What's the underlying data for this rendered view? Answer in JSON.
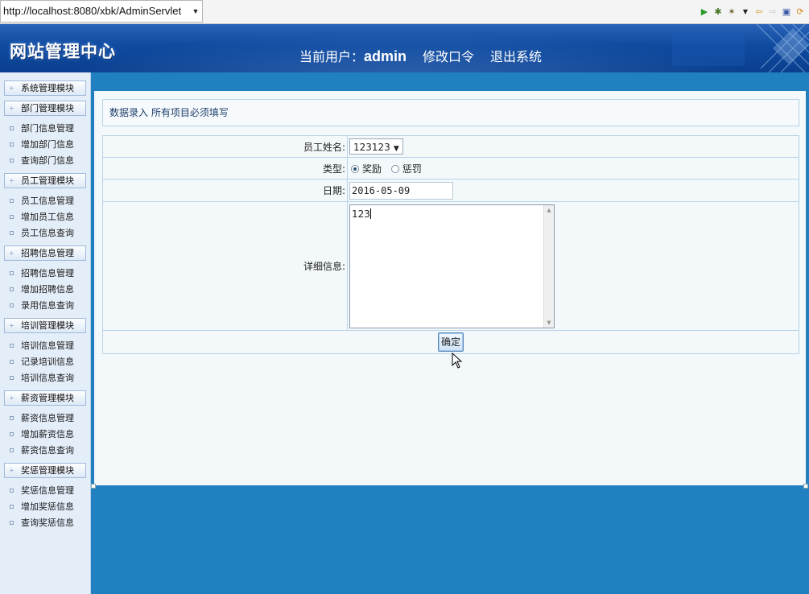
{
  "browser": {
    "url": "http://localhost:8080/xbk/AdminServlet",
    "dropdown_icon": "chevron-down-icon",
    "toolbar_icons": [
      "run-icon",
      "debug-icon",
      "tools-icon",
      "back-icon",
      "forward-icon",
      "stop-icon",
      "refresh-icon"
    ]
  },
  "header": {
    "title": "网站管理中心",
    "current_user_label": "当前用户：",
    "current_user": "admin",
    "change_password": "修改口令",
    "logout": "退出系统"
  },
  "sidebar": {
    "groups": [
      {
        "label": "系统管理模块",
        "items": []
      },
      {
        "label": "部门管理模块",
        "items": [
          "部门信息管理",
          "增加部门信息",
          "查询部门信息"
        ]
      },
      {
        "label": "员工管理模块",
        "items": [
          "员工信息管理",
          "增加员工信息",
          "员工信息查询"
        ]
      },
      {
        "label": "招聘信息管理",
        "items": [
          "招聘信息管理",
          "增加招聘信息",
          "录用信息查询"
        ]
      },
      {
        "label": "培训管理模块",
        "items": [
          "培训信息管理",
          "记录培训信息",
          "培训信息查询"
        ]
      },
      {
        "label": "薪资管理模块",
        "items": [
          "薪资信息管理",
          "增加薪资信息",
          "薪资信息查询"
        ]
      },
      {
        "label": "奖惩管理模块",
        "items": [
          "奖惩信息管理",
          "增加奖惩信息",
          "查询奖惩信息"
        ]
      }
    ]
  },
  "form": {
    "notice": "数据录入  所有项目必须填写",
    "employee_label": "员工姓名:",
    "employee_value": "123123",
    "type_label": "类型:",
    "type_options": [
      "奖励",
      "惩罚"
    ],
    "type_selected": "奖励",
    "date_label": "日期:",
    "date_value": "2016-05-09",
    "detail_label": "详细信息:",
    "detail_value": "123",
    "submit": "确定"
  },
  "colors": {
    "header_blue": "#0f4aa0",
    "main_bg": "#2180bf",
    "panel_bg": "#f3f8fb",
    "sidebar_bg": "#e4eef9"
  }
}
